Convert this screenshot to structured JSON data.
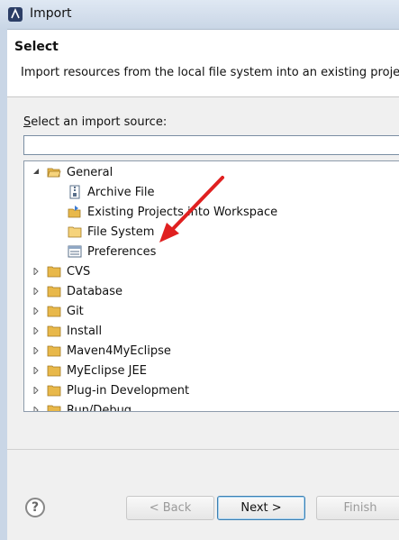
{
  "window": {
    "title": "Import"
  },
  "header": {
    "title": "Select",
    "description": "Import resources from the local file system into an existing projec"
  },
  "source": {
    "label_access": "S",
    "label_rest": "elect an import source:",
    "filter_value": ""
  },
  "tree": {
    "items": [
      {
        "label": "General",
        "level": 0,
        "expanded": true,
        "icon": "folder-open-icon"
      },
      {
        "label": "Archive File",
        "level": 1,
        "icon": "archive-file-icon"
      },
      {
        "label": "Existing Projects into Workspace",
        "level": 1,
        "icon": "existing-project-icon"
      },
      {
        "label": "File System",
        "level": 1,
        "icon": "folder-icon",
        "highlighted": true
      },
      {
        "label": "Preferences",
        "level": 1,
        "icon": "preferences-icon"
      },
      {
        "label": "CVS",
        "level": 0,
        "expanded": false,
        "icon": "folder-icon"
      },
      {
        "label": "Database",
        "level": 0,
        "expanded": false,
        "icon": "folder-icon"
      },
      {
        "label": "Git",
        "level": 0,
        "expanded": false,
        "icon": "folder-icon"
      },
      {
        "label": "Install",
        "level": 0,
        "expanded": false,
        "icon": "folder-icon"
      },
      {
        "label": "Maven4MyEclipse",
        "level": 0,
        "expanded": false,
        "icon": "folder-icon"
      },
      {
        "label": "MyEclipse JEE",
        "level": 0,
        "expanded": false,
        "icon": "folder-icon"
      },
      {
        "label": "Plug-in Development",
        "level": 0,
        "expanded": false,
        "icon": "folder-icon"
      },
      {
        "label": "Run/Debug",
        "level": 0,
        "expanded": false,
        "icon": "folder-icon"
      }
    ]
  },
  "annotation": {
    "color": "#e02020",
    "icon": "red-arrow-icon"
  },
  "footer": {
    "help_label": "?",
    "back_label": "< Back",
    "back_access": "B",
    "next_label": "Next >",
    "next_access": "N",
    "finish_label": "Finish",
    "finish_access": "F"
  },
  "colors": {
    "accent": "#3c7fb1",
    "folder": "#e8b84a"
  }
}
